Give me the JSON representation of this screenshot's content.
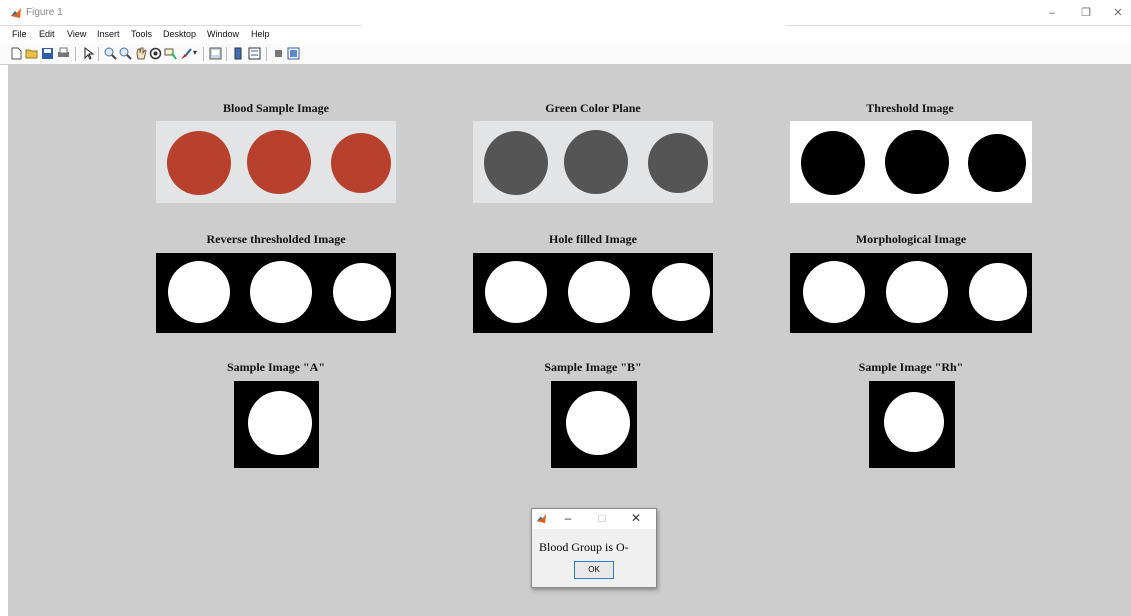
{
  "window": {
    "title": "Figure 1",
    "minimize_glyph": "–",
    "restore_glyph": "❐",
    "close_glyph": "✕"
  },
  "menu": {
    "items": [
      "File",
      "Edit",
      "View",
      "Insert",
      "Tools",
      "Desktop",
      "Window",
      "Help"
    ]
  },
  "toolbar": {
    "icons": [
      "new-figure-icon",
      "open-file-icon",
      "save-figure-icon",
      "print-figure-icon",
      "edit-plot-icon",
      "zoom-in-icon",
      "zoom-out-icon",
      "pan-icon",
      "rotate-3d-icon",
      "data-cursor-icon",
      "brush-icon",
      "link-plot-icon",
      "insert-colorbar-icon",
      "insert-legend-icon",
      "hide-plot-tools-icon",
      "show-plot-tools-icon"
    ]
  },
  "panels": {
    "blood_sample": "Blood Sample Image",
    "green_plane": "Green Color Plane",
    "threshold": "Threshold Image",
    "reverse_threshold": "Reverse thresholded Image",
    "hole_filled": "Hole filled Image",
    "morphological": "Morphological Image",
    "sample_a": "Sample Image \"A\"",
    "sample_b": "Sample Image \"B\"",
    "sample_rh": "Sample Image \"Rh\""
  },
  "dialog": {
    "message": "Blood Group is O-",
    "ok_label": "OK",
    "minimize_glyph": "–",
    "maximize_glyph": "□",
    "close_glyph": "✕"
  },
  "colors": {
    "canvas_bg": "#cdcdcd",
    "blood_red": "#b8412e",
    "green_plane_gray": "#555555",
    "sample_bg": "#e2e4e6"
  }
}
